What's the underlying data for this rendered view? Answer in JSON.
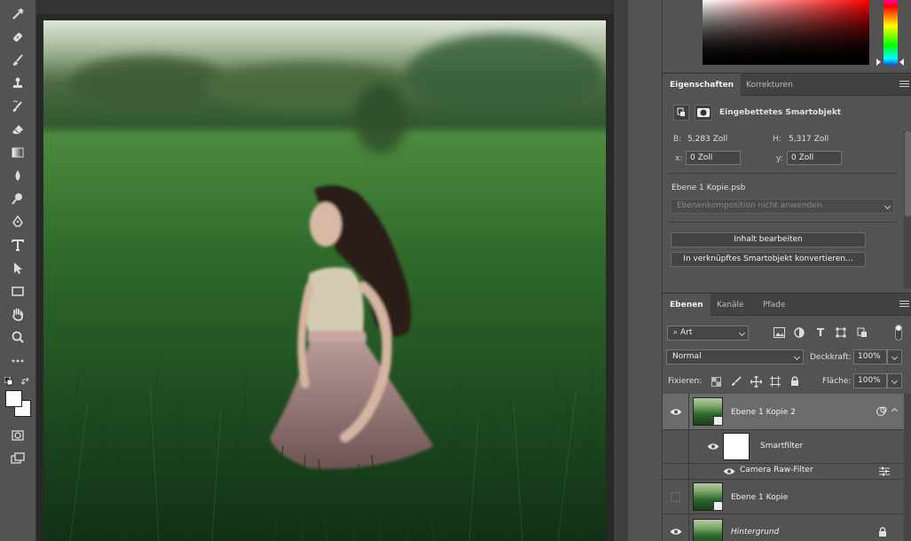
{
  "properties_panel": {
    "tabs": [
      "Eigenschaften",
      "Korrekturen"
    ],
    "object_type": "Eingebettetes Smartobjekt",
    "width_label": "B:",
    "width_value": "5,283 Zoll",
    "height_label": "H:",
    "height_value": "5,317 Zoll",
    "x_label": "x:",
    "x_value": "0 Zoll",
    "y_label": "y:",
    "y_value": "0 Zoll",
    "source_file": "Ebene 1 Kopie.psb",
    "comp_select": "Ebenenkomposition nicht anwenden",
    "edit_contents_button": "Inhalt bearbeiten",
    "convert_button": "In verknüpftes Smartobjekt konvertieren..."
  },
  "layers_panel": {
    "tabs": [
      "Ebenen",
      "Kanäle",
      "Pfade"
    ],
    "filter_kind": "Art",
    "blend_mode": "Normal",
    "opacity_label": "Deckkraft:",
    "opacity_value": "100%",
    "lock_label": "Fixieren:",
    "fill_label": "Fläche:",
    "fill_value": "100%",
    "layers": [
      {
        "name": "Ebene 1 Kopie 2",
        "visible": true,
        "selected": true,
        "smart_object": true
      },
      {
        "name": "Smartfilter",
        "visible": true,
        "type": "smart-filter-mask"
      },
      {
        "name": "Camera Raw-Filter",
        "visible": true,
        "type": "filter"
      },
      {
        "name": "Ebene 1 Kopie",
        "visible": false,
        "smart_object": true
      },
      {
        "name": "Hintergrund",
        "visible": true,
        "locked": true,
        "italic": true
      }
    ]
  },
  "icons": {
    "toolbar": [
      "eyedropper-icon",
      "healing-brush-icon",
      "brush-icon",
      "clone-stamp-icon",
      "history-brush-icon",
      "eraser-icon",
      "gradient-icon",
      "blur-icon",
      "dodge-icon",
      "pen-icon",
      "type-icon",
      "path-selection-icon",
      "rectangle-icon",
      "hand-icon",
      "zoom-icon",
      "more-tools-icon"
    ]
  },
  "colors": {
    "panel_bg": "#535353",
    "tab_bar_bg": "#424242",
    "canvas_bg": "#282828",
    "selected_layer": "#6b6b6b"
  }
}
